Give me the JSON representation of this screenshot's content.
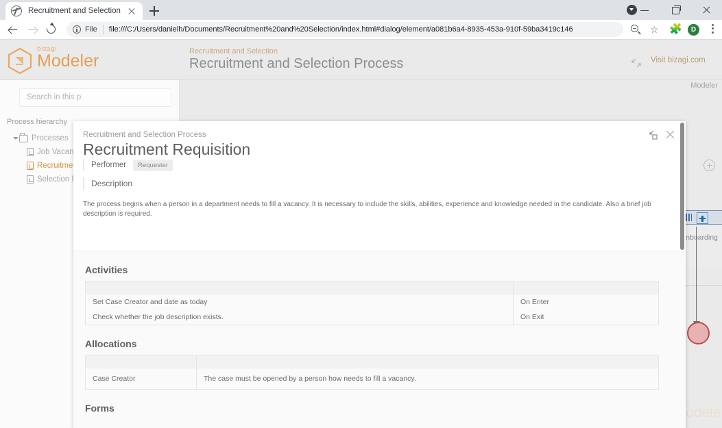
{
  "browser": {
    "tab": {
      "title": "Recruitment and Selection",
      "favicon": "globe-icon",
      "close": "close-icon"
    },
    "new_tab": "+",
    "nav": {
      "back": "back-arrow-icon",
      "forward": "forward-arrow-icon",
      "reload": "reload-icon"
    },
    "omnibox": {
      "info_icon": "info-circle-icon",
      "scheme_label": "File",
      "url": "file:///C:/Users/danielh/Documents/Recruitment%20and%20Selection/index.html#dialog/element/a081b6a4-8935-453a-910f-59ba3419c146"
    },
    "toolbar_icons": {
      "zoom": "zoom-out-icon",
      "bookmark": "star-icon",
      "extensions": "puzzle-icon",
      "profile_initial": "D",
      "menu": "kebab-menu-icon"
    },
    "window": {
      "download_badge": "download-icon",
      "minimize": "minimize-icon",
      "maximize": "maximize-icon",
      "close": "close-icon"
    }
  },
  "app": {
    "brand_small": "bizagi",
    "brand_name": "Modeler",
    "breadcrumb": "Recruitment and Selection",
    "title": "Recruitment and Selection Process",
    "expand_icon": "collapse-arrows-icon",
    "visit_link": "Visit bizagi.com",
    "accent_color": "#e39f57"
  },
  "sidebar": {
    "search_placeholder": "Search in this p",
    "hierarchy_label": "Process hierarchy",
    "tree": [
      {
        "label": "Processes",
        "icon": "folder-icon",
        "level": 0,
        "selected": false,
        "caret": true
      },
      {
        "label": "Job Vacancy",
        "icon": "document-icon",
        "level": 1,
        "selected": false,
        "caret": false
      },
      {
        "label": "Recruitment",
        "icon": "document-icon",
        "level": 1,
        "selected": true,
        "caret": false
      },
      {
        "label": "Selection Pr",
        "icon": "document-icon",
        "level": 1,
        "selected": false,
        "caret": false
      }
    ]
  },
  "canvas": {
    "modeler_tag": "Modeler",
    "zoom_in_icon": "zoom-in-icon",
    "lane_bars_icon": "lane-handle-icon",
    "lane_plus_icon": "expand-plus-icon",
    "task_label": "Onboarding",
    "end_event": "end-event-circle",
    "watermark_small": "bizagi",
    "watermark_name": "Modeler"
  },
  "dialog": {
    "breadcrumb": "Recruitment and Selection Process",
    "title": "Recruitment Requisition",
    "performer_label": "Performer",
    "performer_value": "Requester",
    "description_label": "Description",
    "description_text": "The process begins when a person in a department needs to fill a vacancy. It is necessary to include the skills, abilities, experience and knowledge needed in the candidate. Also a brief job description is required.",
    "expand_icon": "expand-arrows-icon",
    "close_icon": "close-icon",
    "sections": {
      "activities": {
        "title": "Activities",
        "rows": [
          {
            "name": "Set Case Creator and date as today",
            "trigger": "On Enter"
          },
          {
            "name": "Check whether the job description exists.",
            "trigger": "On Exit"
          }
        ]
      },
      "allocations": {
        "title": "Allocations",
        "rows": [
          {
            "name": "Case Creator",
            "detail": "The case must be opened by a person how needs to fill a vacancy."
          }
        ]
      },
      "forms": {
        "title": "Forms"
      }
    }
  }
}
